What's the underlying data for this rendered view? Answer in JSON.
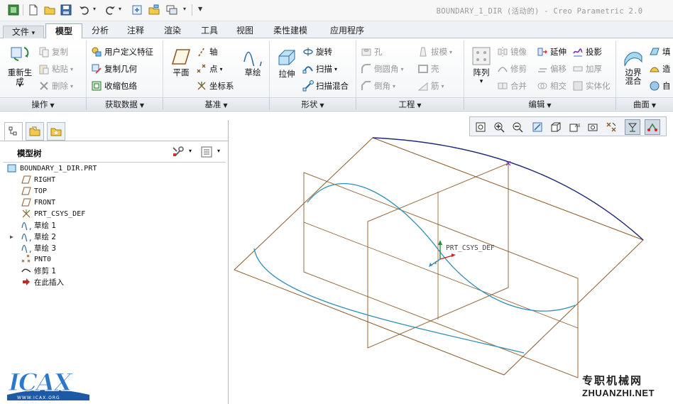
{
  "window": {
    "title": "BOUNDARY_1_DIR (活动的) - Creo Parametric 2.0"
  },
  "tabs": [
    {
      "label": "文件",
      "dropdown": "▾"
    },
    {
      "label": "模型"
    },
    {
      "label": "分析"
    },
    {
      "label": "注释"
    },
    {
      "label": "渲染"
    },
    {
      "label": "工具"
    },
    {
      "label": "视图"
    },
    {
      "label": "柔性建模"
    },
    {
      "label": "应用程序"
    }
  ],
  "ribbon": {
    "operations": {
      "label": "操作",
      "regenerate": "重新生成",
      "copy": "复制",
      "paste": "粘贴",
      "delete": "删除"
    },
    "get_data": {
      "label": "获取数据",
      "udf": "用户定义特征",
      "copy_geom": "复制几何",
      "shrinkwrap": "收缩包络"
    },
    "datum": {
      "label": "基准",
      "plane": "平面",
      "axis": "轴",
      "point": "点",
      "csys": "坐标系",
      "sketch": "草绘"
    },
    "shapes": {
      "label": "形状",
      "extrude": "拉伸",
      "revolve": "旋转",
      "sweep": "扫描",
      "swept_blend": "扫描混合"
    },
    "engineering": {
      "label": "工程",
      "hole": "孔",
      "round": "倒圆角",
      "chamfer": "倒角",
      "draft": "拔模",
      "shell": "壳",
      "rib": "筋"
    },
    "editing": {
      "label": "编辑",
      "pattern": "阵列",
      "mirror": "镜像",
      "trim": "修剪",
      "merge": "合并",
      "extend": "延伸",
      "offset": "偏移",
      "intersect": "相交",
      "project": "投影",
      "thicken": "加厚",
      "solidify": "实体化"
    },
    "surfaces": {
      "label": "曲面",
      "boundary_blend": "边界混合",
      "fill": "填",
      "style": "造",
      "freestyle": "自"
    }
  },
  "model_tree": {
    "title": "模型树",
    "items": [
      {
        "label": "BOUNDARY_1_DIR.PRT",
        "icon": "part-icon",
        "expandable": false
      },
      {
        "label": "RIGHT",
        "icon": "datum-plane-icon",
        "expandable": false
      },
      {
        "label": "TOP",
        "icon": "datum-plane-icon",
        "expandable": false
      },
      {
        "label": "FRONT",
        "icon": "datum-plane-icon",
        "expandable": false
      },
      {
        "label": "PRT_CSYS_DEF",
        "icon": "csys-icon",
        "expandable": false
      },
      {
        "label": "草绘 1",
        "icon": "sketch-icon",
        "expandable": false
      },
      {
        "label": "草绘 2",
        "icon": "sketch-icon",
        "expandable": true
      },
      {
        "label": "草绘 3",
        "icon": "sketch-icon",
        "expandable": false
      },
      {
        "label": "PNT0",
        "icon": "datum-point-icon",
        "expandable": false
      },
      {
        "label": "修剪 1",
        "icon": "trim-curve-icon",
        "expandable": false
      },
      {
        "label": "在此插入",
        "icon": "insert-here-arrow-icon",
        "expandable": false
      }
    ]
  },
  "graphics": {
    "csys_label": "PRT_CSYS_DEF",
    "curve_color": "#2e8fb8",
    "arc_color": "#1f2a78",
    "datum_color": "#8b5a2b"
  },
  "watermark": {
    "logo_text": "ICAX",
    "logo_url": "WWW.ICAX.ORG",
    "site_cn": "专职机械网",
    "site_en": "ZHUANZHI.NET"
  }
}
